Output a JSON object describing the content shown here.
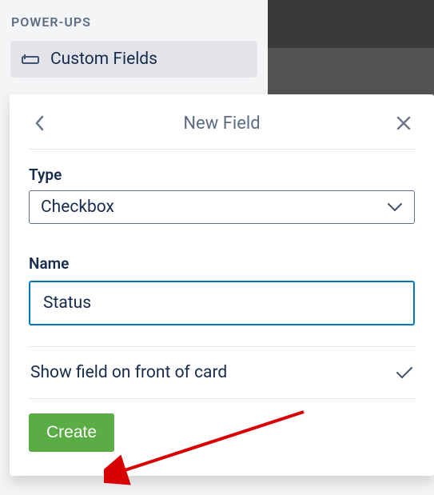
{
  "sidebar": {
    "heading": "POWER-UPS",
    "item": {
      "label": "Custom Fields"
    }
  },
  "modal": {
    "title": "New Field",
    "type_label": "Type",
    "type_value": "Checkbox",
    "name_label": "Name",
    "name_value": "Status",
    "toggle_label": "Show field on front of card",
    "create_label": "Create"
  }
}
